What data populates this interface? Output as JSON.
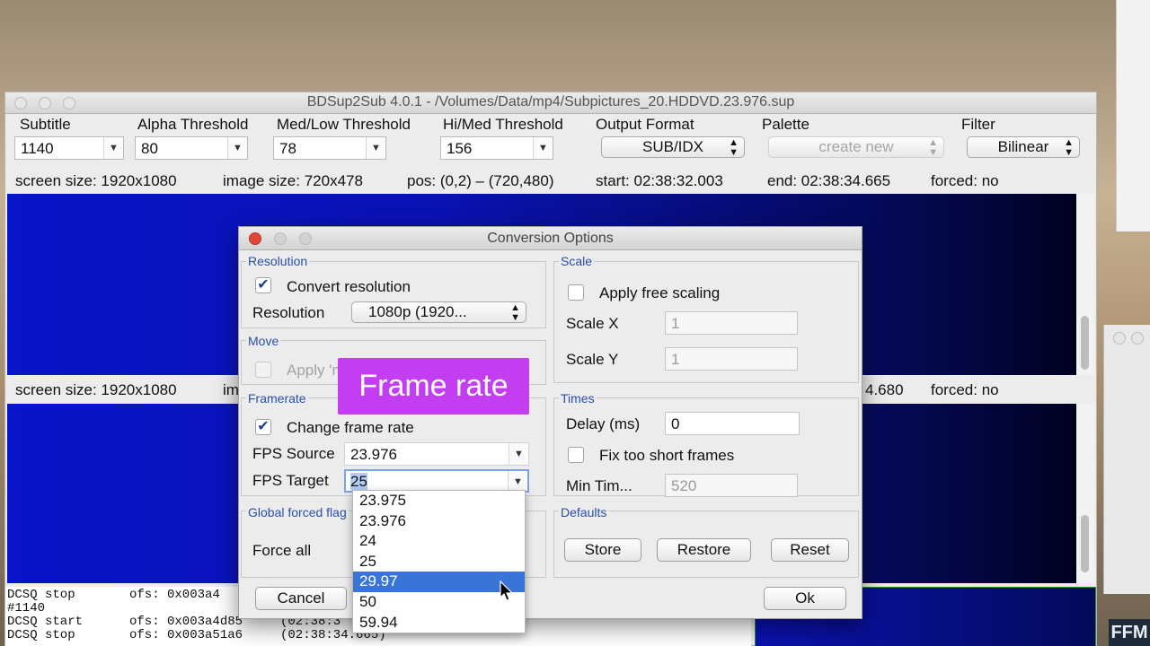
{
  "main_window": {
    "title": "BDSup2Sub 4.0.1 - /Volumes/Data/mp4/Subpictures_20.HDDVD.23.976.sup",
    "toolbar": {
      "subtitle_label": "Subtitle",
      "subtitle_value": "1140",
      "alpha_label": "Alpha Threshold",
      "alpha_value": "80",
      "medlow_label": "Med/Low Threshold",
      "medlow_value": "78",
      "himed_label": "Hi/Med Threshold",
      "himed_value": "156",
      "output_label": "Output Format",
      "output_value": "SUB/IDX",
      "palette_label": "Palette",
      "palette_value": "create new",
      "filter_label": "Filter",
      "filter_value": "Bilinear"
    },
    "info_top": {
      "screen": "screen size: 1920x1080",
      "image": "image size: 720x478",
      "pos": "pos: (0,2) – (720,480)",
      "start": "start: 02:38:32.003",
      "end": "end: 02:38:34.665",
      "forced": "forced: no"
    },
    "info_bottom": {
      "screen": "screen size: 1920x1080",
      "image_partial": "im",
      "end_partial": "4.680",
      "forced": "forced: no"
    },
    "log": [
      {
        "c1": "DCSQ stop",
        "c2": "ofs: 0x003a4",
        "c3": ""
      },
      {
        "c1": "#1140",
        "c2": "",
        "c3": ""
      },
      {
        "c1": "DCSQ start",
        "c2": "ofs: 0x003a4d85",
        "c3": "(02:38:3"
      },
      {
        "c1": "DCSQ stop",
        "c2": "ofs: 0x003a51a6",
        "c3": "(02:38:34.665)"
      }
    ]
  },
  "dialog": {
    "title": "Conversion Options",
    "resolution": {
      "legend": "Resolution",
      "convert_label": "Convert resolution",
      "resolution_label": "Resolution",
      "resolution_value": "1080p (1920..."
    },
    "move": {
      "legend": "Move",
      "apply_label": "Apply 'move all' settings"
    },
    "framerate": {
      "legend": "Framerate",
      "change_label": "Change frame rate",
      "source_label": "FPS Source",
      "source_value": "23.976",
      "target_label": "FPS Target",
      "target_value": "25"
    },
    "forced": {
      "legend": "Global forced flag",
      "force_label": "Force all"
    },
    "scale": {
      "legend": "Scale",
      "apply_label": "Apply free scaling",
      "x_label": "Scale X",
      "x_value": "1",
      "y_label": "Scale Y",
      "y_value": "1"
    },
    "times": {
      "legend": "Times",
      "delay_label": "Delay (ms)",
      "delay_value": "0",
      "fix_label": "Fix too short frames",
      "min_label": "Min Tim...",
      "min_value": "520"
    },
    "defaults": {
      "legend": "Defaults",
      "store": "Store",
      "restore": "Restore",
      "reset": "Reset"
    },
    "cancel": "Cancel",
    "ok": "Ok",
    "fps_options": [
      "23.975",
      "23.976",
      "24",
      "25",
      "29.97",
      "50",
      "59.94"
    ],
    "fps_selected": "29.97"
  },
  "overlay_caption": "Frame rate",
  "watermark": "FFM"
}
